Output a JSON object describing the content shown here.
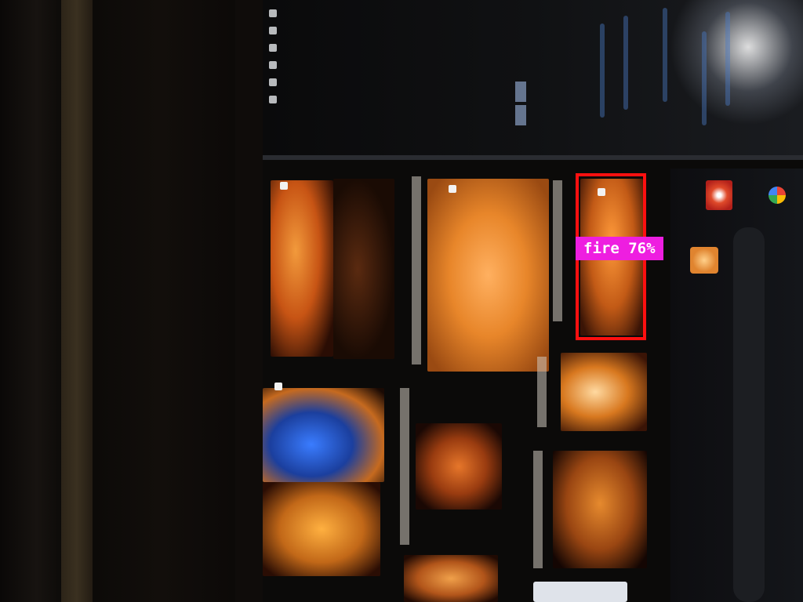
{
  "detection": {
    "label": "fire 76%",
    "class": "fire",
    "confidence": 0.76,
    "box_color": "#ff1010",
    "label_bg_color": "#ee1ee0"
  }
}
